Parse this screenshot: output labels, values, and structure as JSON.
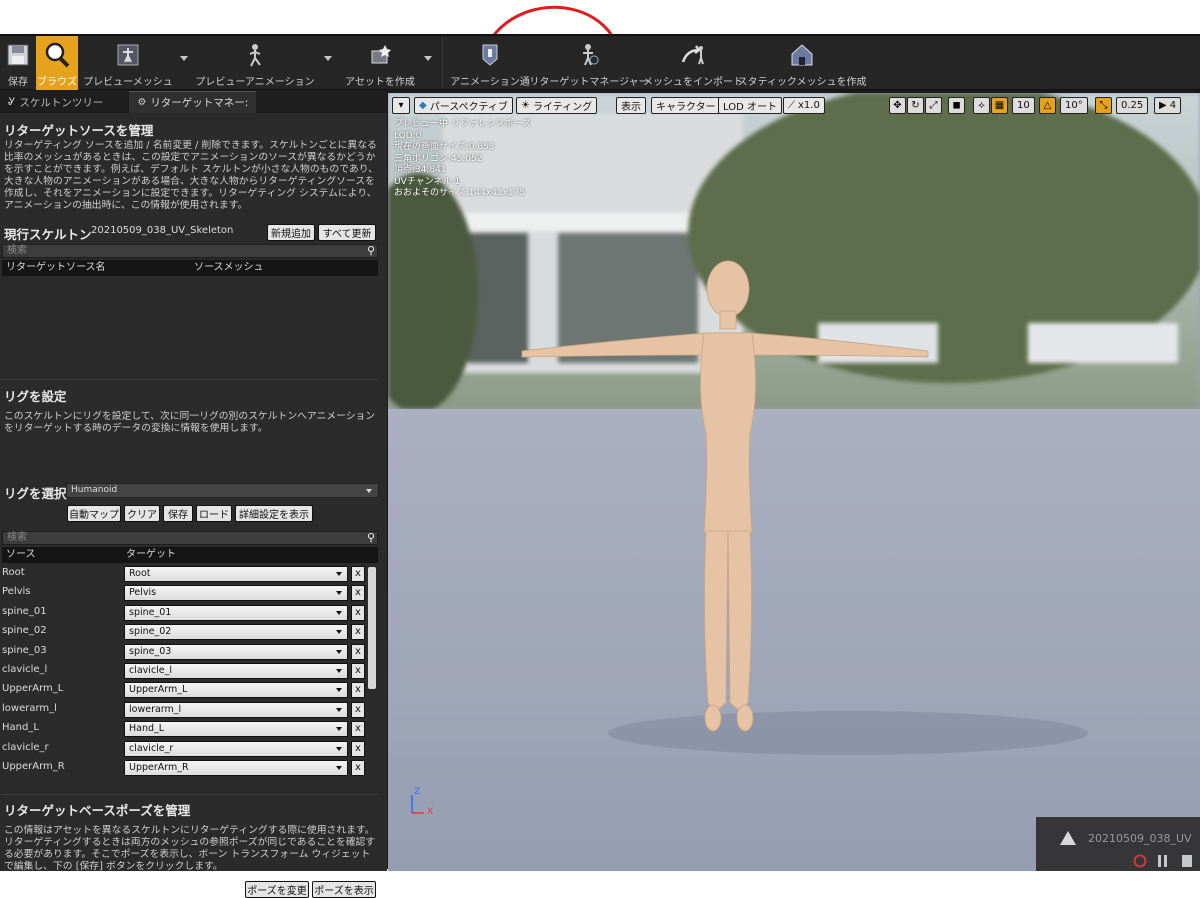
{
  "toolbar": {
    "items": [
      {
        "label": "保存",
        "icon": "save-icon"
      },
      {
        "label": "ブラウズ",
        "icon": "browse-icon",
        "active": true
      },
      {
        "label": "プレビューメッシュ",
        "icon": "preview-mesh-icon"
      },
      {
        "label": "プレビューアニメーション",
        "icon": "preview-animation-icon"
      },
      {
        "label": "アセットを作成",
        "icon": "create-asset-icon"
      },
      {
        "label": "アニメーション通",
        "icon": "animation-notify-icon"
      },
      {
        "label": "リターゲットマネージャー",
        "icon": "retarget-manager-icon"
      },
      {
        "label": "メッシュをインポート",
        "icon": "import-mesh-icon"
      },
      {
        "label": "スタティックメッシュを作成",
        "icon": "static-mesh-icon"
      }
    ]
  },
  "tabs": {
    "skeleton_tree": "スケルトンツリー",
    "retarget_manager": "リターゲットマネー:"
  },
  "source": {
    "title": "リターゲットソースを管理",
    "description": "リターゲティング ソースを追加 / 名前変更 / 削除できます。スケルトンごとに異なる比率のメッシュがあるときは、この設定でアニメーションのソースが異なるかどうかを示すことができます。例えば、デフォルト スケルトンが小さな人物のものであり、大きな人物のアニメーションがある場合、大きな人物からリターゲティングソースを作成し、それをアニメーションに設定できます。リターゲティング システムにより、アニメーションの抽出時に、この情報が使用されます。",
    "current_skeleton_label": "現行スケルトン",
    "current_skeleton": "20210509_038_UV_Skeleton",
    "add_new": "新規追加",
    "update_all": "すべて更新",
    "search_placeholder": "検索",
    "col_source_name": "リターゲットソース名",
    "col_source_mesh": "ソースメッシュ"
  },
  "rig": {
    "title": "リグを設定",
    "description": "このスケルトンにリグを設定して、次に同一リグの別のスケルトンへアニメーションをリターゲットする時のデータの変換に情報を使用します。",
    "select_label": "リグを選択",
    "selected_rig": "Humanoid",
    "auto_map": "自動マップ",
    "clear": "クリア",
    "save": "保存",
    "load": "ロード",
    "show_advanced": "詳細設定を表示",
    "search_placeholder": "検索",
    "col_source": "ソース",
    "col_target": "ターゲット",
    "mappings": [
      {
        "source": "Root",
        "target": "Root"
      },
      {
        "source": "Pelvis",
        "target": "Pelvis"
      },
      {
        "source": "spine_01",
        "target": "spine_01"
      },
      {
        "source": "spine_02",
        "target": "spine_02"
      },
      {
        "source": "spine_03",
        "target": "spine_03"
      },
      {
        "source": "clavicle_l",
        "target": "clavicle_l"
      },
      {
        "source": "UpperArm_L",
        "target": "UpperArm_L"
      },
      {
        "source": "lowerarm_l",
        "target": "lowerarm_l"
      },
      {
        "source": "Hand_L",
        "target": "Hand_L"
      },
      {
        "source": "clavicle_r",
        "target": "clavicle_r"
      },
      {
        "source": "UpperArm_R",
        "target": "UpperArm_R"
      }
    ],
    "clear_x": "x"
  },
  "base_pose": {
    "title": "リターゲットベースポーズを管理",
    "description": "この情報はアセットを異なるスケルトンにリターゲティングする際に使用されます。リターゲティングするときは両方のメッシュの参照ポーズが同じであることを確認する必要があります。そこでポーズを表示し、ボーン トランスフォーム ウィジェットで編集し、下の [保存] ボタンをクリックします。",
    "modify_pose": "ポーズを変更",
    "view_pose": "ポーズを表示"
  },
  "viewport": {
    "perspective": "パースペクティブ",
    "lighting": "ライティング",
    "show": "表示",
    "character": "キャラクター",
    "lod": "LOD オート",
    "speed": "x1.0",
    "grid_value": "10",
    "angle_value": "10°",
    "scale_value": "0.25",
    "camera_speed": "4",
    "stats": [
      "プレビュー中 リファレンスポーズ",
      "LOD:0",
      "現在の画面サイズ:0.853",
      "三角ポリゴン:45,052",
      "頂点:34,841",
      "UVチャンネル:1",
      "おおよそのサイズ:144x41x175"
    ],
    "notice": "20210509_038_UV",
    "axis_z": "Z",
    "axis_x": "X"
  },
  "colors": {
    "accent": "#e6a11d",
    "annotation": "#e01b1b"
  }
}
